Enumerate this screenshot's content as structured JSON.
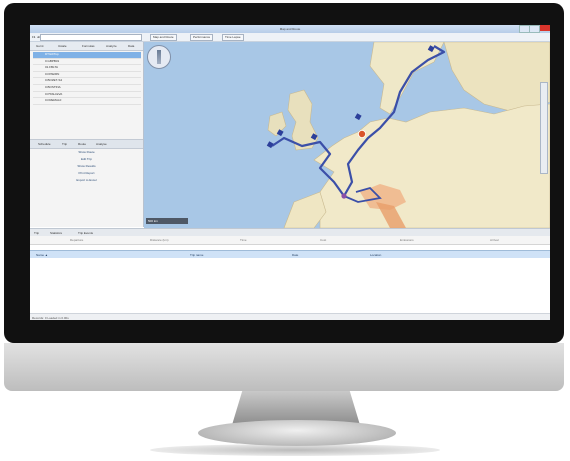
{
  "app": {
    "title": "Map and Route",
    "toolbar": {
      "label": "Fil. ultra",
      "tabs": [
        "Map and Route",
        "Performance",
        "Time Lapse"
      ]
    },
    "left_panel": {
      "columns": [
        "Gurnt",
        "Ustale",
        "Formulas",
        "Analyze",
        "Data"
      ],
      "tree_items": [
        "DTG0/Top",
        "0.GBPB31",
        "01.FBLTA",
        "0.FPIEIRN",
        "0.BOZET-S4",
        "0.BOSTINA",
        "0.PSSH.EVA",
        "0.FREMAL0"
      ],
      "tabs": [
        "Schedule",
        "Trip",
        "Route",
        "Analyse"
      ],
      "actions": [
        "Show Route",
        "Edit Trip",
        "Show Results",
        "Print Report",
        "Export to Excel"
      ]
    },
    "map": {
      "scale_label": "500 km",
      "colors": {
        "sea": "#a8c7e6",
        "land": "#efe8c8",
        "route": "#3b4fa8",
        "hot": "#e46b2a"
      }
    },
    "bottom": {
      "tabs": [
        "Trip",
        "Statistics",
        "Trip Events"
      ],
      "steps": [
        "Departure",
        "Distance (km)",
        "Time",
        "Cost",
        "Emissions",
        "Arrival"
      ],
      "grid_columns": [
        "Name ▲",
        "Trip name",
        "Date",
        "Location"
      ],
      "status": "Records: 0   Loaded in 0.00s"
    }
  }
}
